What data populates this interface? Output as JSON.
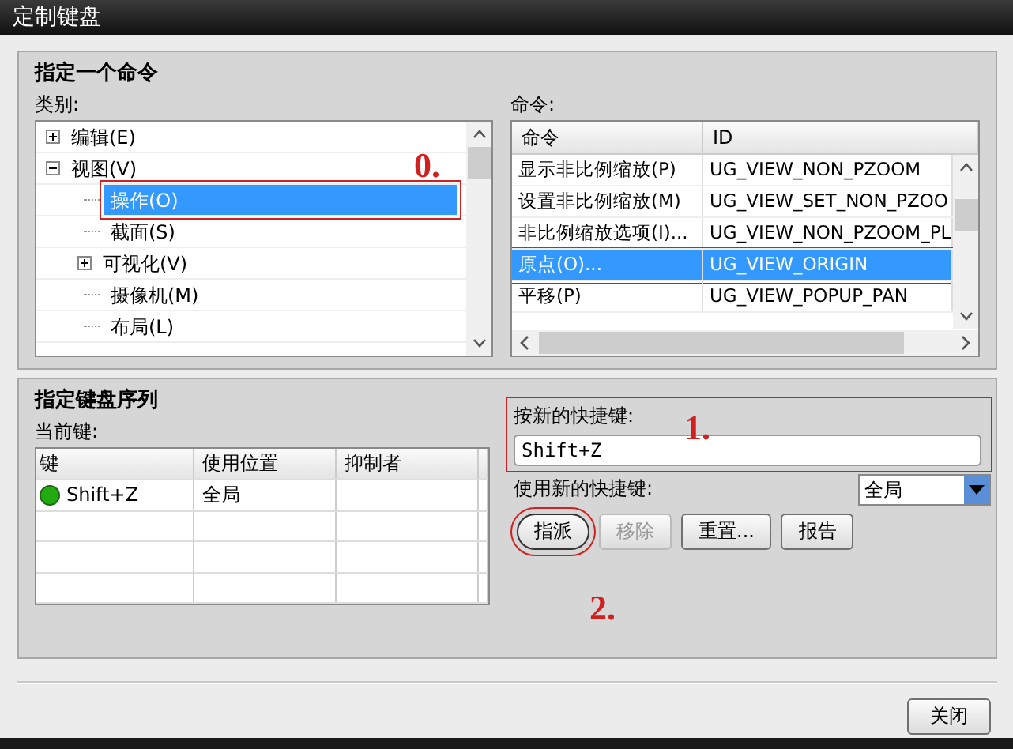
{
  "window": {
    "title": "定制键盘"
  },
  "command_group": {
    "title": "指定一个命令",
    "category_label": "类别:",
    "command_label": "命令:",
    "category_tree": [
      {
        "label": "编辑(E)",
        "expanded": false,
        "selected": false,
        "highlighted": false
      },
      {
        "label": "视图(V)",
        "expanded": true,
        "selected": false,
        "highlighted": false,
        "children": [
          {
            "label": "操作(O)",
            "selected": true,
            "highlighted": true
          },
          {
            "label": "截面(S)",
            "selected": false,
            "highlighted": false
          },
          {
            "label": "可视化(V)",
            "expanded": false,
            "selected": false,
            "highlighted": false
          },
          {
            "label": "摄像机(M)",
            "selected": false,
            "highlighted": false
          },
          {
            "label": "布局(L)",
            "selected": false,
            "highlighted": false
          }
        ]
      }
    ],
    "command_table": {
      "columns": [
        "命令",
        "ID"
      ],
      "rows": [
        {
          "command": "显示非比例缩放(P)",
          "id": "UG_VIEW_NON_PZOOM",
          "selected": false,
          "highlighted": false
        },
        {
          "command": "设置非比例缩放(M)",
          "id": "UG_VIEW_SET_NON_PZOO",
          "selected": false,
          "highlighted": false
        },
        {
          "command": "非比例缩放选项(I)...",
          "id": "UG_VIEW_NON_PZOOM_PL",
          "selected": false,
          "highlighted": false
        },
        {
          "command": "原点(O)...",
          "id": "UG_VIEW_ORIGIN",
          "selected": true,
          "highlighted": true
        },
        {
          "command": "平移(P)",
          "id": "UG_VIEW_POPUP_PAN",
          "selected": false,
          "highlighted": false
        }
      ]
    }
  },
  "key_group": {
    "title": "指定键盘序列",
    "current_label": "当前键:",
    "key_table": {
      "columns": [
        "键",
        "使用位置",
        "抑制者"
      ],
      "rows": [
        {
          "key": "Shift+Z",
          "color": "#22aa11",
          "location": "全局"
        }
      ]
    },
    "new_shortcut": {
      "label": "按新的快捷键:",
      "value": "Shift+Z",
      "highlighted": true
    },
    "use_label": "使用新的快捷键:",
    "scope": "全局",
    "buttons": [
      {
        "label": "指派",
        "disabled": false,
        "focused": true,
        "highlighted": true
      },
      {
        "label": "移除",
        "disabled": true,
        "focused": false,
        "highlighted": false
      },
      {
        "label": "重置...",
        "disabled": false,
        "focused": false,
        "highlighted": false
      },
      {
        "label": "报告",
        "disabled": false,
        "focused": false,
        "highlighted": false
      }
    ]
  },
  "close_button": "关闭",
  "annotations": [
    {
      "text": "0."
    },
    {
      "text": "1."
    },
    {
      "text": "2."
    }
  ]
}
